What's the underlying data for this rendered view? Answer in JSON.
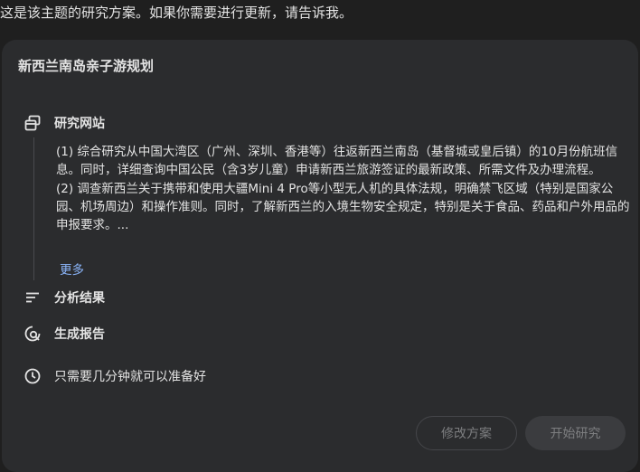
{
  "intro_text": "这是该主题的研究方案。如果你需要进行更新，请告诉我。",
  "card": {
    "title": "新西兰南岛亲子游规划",
    "steps": [
      {
        "label": "研究网站",
        "icon": "research-websites-icon"
      },
      {
        "label": "分析结果",
        "icon": "analyze-results-icon"
      },
      {
        "label": "生成报告",
        "icon": "generate-report-icon"
      },
      {
        "label": "只需要几分钟就可以准备好",
        "icon": "clock-icon"
      }
    ],
    "research_items": [
      "(1) 综合研究从中国大湾区（广州、深圳、香港等）往返新西兰南岛（基督城或皇后镇）的10月份航班信息。同时，详细查询中国公民（含3岁儿童）申请新西兰旅游签证的最新政策、所需文件及办理流程。",
      "(2) 调查新西兰关于携带和使用大疆Mini 4 Pro等小型无人机的具体法规，明确禁飞区域（特别是国家公园、机场周边）和操作准则。同时，了解新西兰的入境生物安全规定，特别是关于食品、药品和户外用品的申报要求。..."
    ],
    "more_label": "更多",
    "buttons": {
      "edit": "修改方案",
      "start": "开始研究"
    }
  },
  "colors": {
    "background": "#1f1f1f",
    "card": "#2b2c2e",
    "link": "#8ab4f8",
    "text": "#e3e3e3",
    "disabled_text": "#7d7e80"
  }
}
